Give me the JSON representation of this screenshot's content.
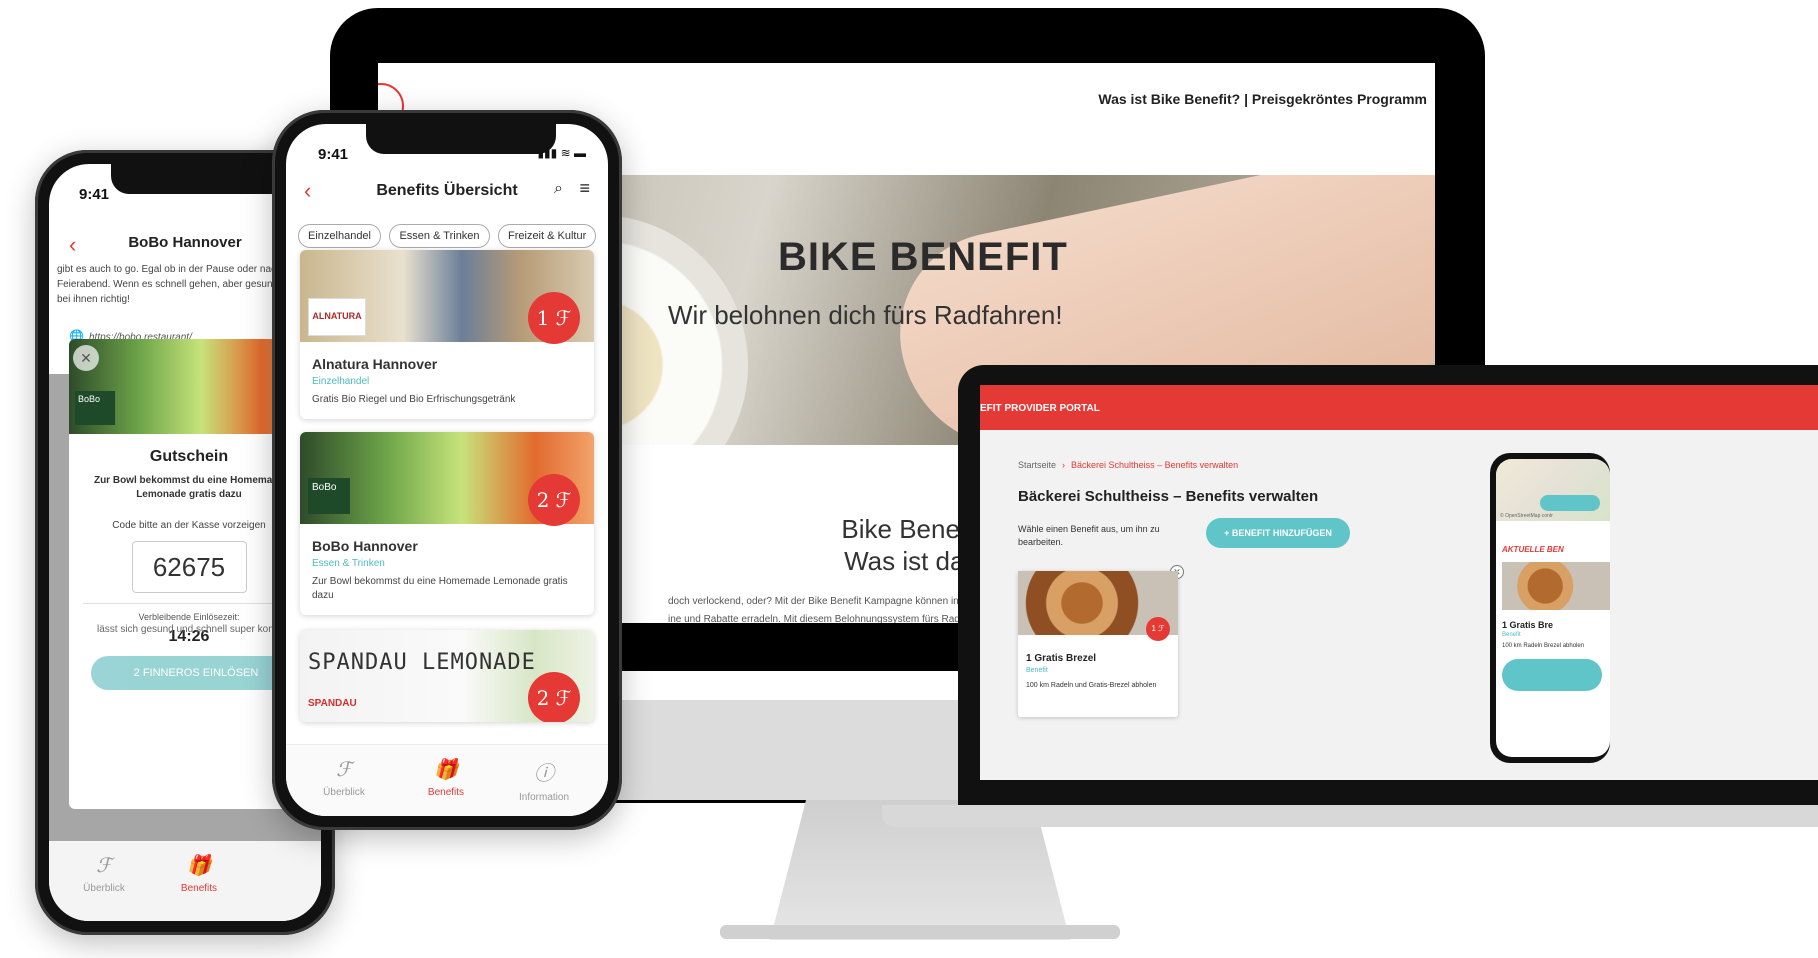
{
  "desktop": {
    "nav_text": "Was ist Bike Benefit? | Preisgekröntes Programm",
    "hero_title": "BIKE BENEFIT",
    "hero_subtitle": "Wir belohnen dich fürs Radfahren!",
    "question_line1": "Bike Benefit?",
    "question_line2": "Was ist das?",
    "body_line1": "doch verlockend, oder? Mit der Bike Benefit Kampagne können in Kooperation mit",
    "body_line2": "ine und Rabatte erradeln. Mit diesem Belohnungssystem fürs Radfahren, werden d"
  },
  "left_phone": {
    "time": "9:41",
    "title": "BoBo Hannover",
    "intro_text": "gibt es auch to go. Egal ob in der Pause oder nach Feierabend. Wenn es schnell gehen, aber gesund bist du bei ihnen richtig!",
    "url": "https://bobo.restaurant/",
    "voucher": {
      "brand_badge": "BoBo",
      "title": "Gutschein",
      "description": "Zur Bowl bekommst du eine Homemade Lemonade gratis dazu",
      "hint": "Code bitte an der Kasse vorzeigen",
      "code": "62675",
      "remaining_label": "Verbleibende Einlösezeit:",
      "remaining_time": "14:26"
    },
    "bottom_text": "lässt sich gesund und schnell super kombinieren",
    "redeem_button": "2 FINNEROS EINLÖSEN",
    "tabs": [
      {
        "icon": "ℱ",
        "label": "Überblick"
      },
      {
        "icon": "🎁",
        "label": "Benefits"
      }
    ]
  },
  "mid_phone": {
    "time": "9:41",
    "title": "Benefits Übersicht",
    "chips": [
      "Einzelhandel",
      "Essen & Trinken",
      "Freizeit & Kultur"
    ],
    "cards": [
      {
        "name": "Alnatura Hannover",
        "category": "Einzelhandel",
        "description": "Gratis Bio Riegel und Bio Erfrischungsgetränk",
        "badge": "1 ℱ",
        "logo": "ALNATURA"
      },
      {
        "name": "BoBo Hannover",
        "category": "Essen & Trinken",
        "description": "Zur Bowl bekommst du eine Homemade Lemonade gratis dazu",
        "badge": "2 ℱ",
        "logo": "BoBo"
      },
      {
        "name": "",
        "category": "",
        "description": "",
        "badge": "2 ℱ",
        "logo": "SPANDAU LEMONADE",
        "sublogo": "SPANDAU"
      }
    ],
    "tabs": [
      {
        "icon": "ℱ",
        "label": "Überblick"
      },
      {
        "icon": "🎁",
        "label": "Benefits"
      },
      {
        "icon": "ⓘ",
        "label": "Information"
      }
    ]
  },
  "laptop": {
    "header": "EFIT PROVIDER PORTAL",
    "breadcrumb_home": "Startseite",
    "breadcrumb_current": "Bäckerei Schultheiss – Benefits verwalten",
    "title": "Bäckerei Schultheiss – Benefits verwalten",
    "instruction": "Wähle einen Benefit aus, um ihn zu bearbeiten.",
    "add_button": "+ BENEFIT HINZUFÜGEN",
    "card": {
      "name": "1 Gratis Brezel",
      "category": "Benefit",
      "description": "100 km Radeln und Gratis-Brezel abholen",
      "badge": "1 ℱ"
    },
    "mini_phone": {
      "map_credit": "© OpenStreetMap contr",
      "section": "AKTUELLE BEN",
      "name": "1 Gratis Bre",
      "category": "Benefit",
      "description": "100 km Radeln Brezel abholen"
    }
  },
  "colors": {
    "accent_red": "#e53935",
    "accent_teal": "#5fc5c8"
  }
}
